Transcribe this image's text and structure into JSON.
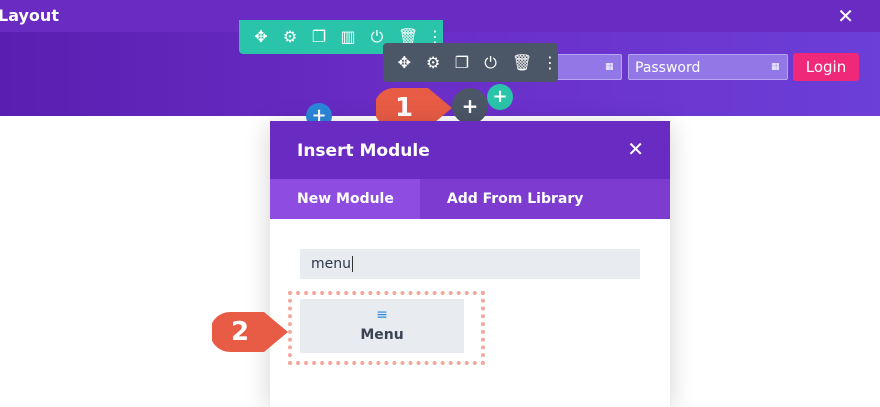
{
  "titlebar": {
    "title": "Layout",
    "close_icon": "close-icon"
  },
  "green_toolbar": {
    "icons": [
      "move-icon",
      "gear-icon",
      "duplicate-icon",
      "columns-icon",
      "power-icon",
      "trash-icon",
      "more-icon"
    ]
  },
  "gray_toolbar": {
    "icons": [
      "move-icon",
      "gear-icon",
      "duplicate-icon",
      "power-icon",
      "trash-icon",
      "more-icon"
    ]
  },
  "login_form": {
    "password_placeholder": "Password",
    "login_label": "Login"
  },
  "callouts": {
    "first": "1",
    "second": "2"
  },
  "modal": {
    "title": "Insert Module",
    "tabs": [
      {
        "label": "New Module",
        "active": true
      },
      {
        "label": "Add From Library",
        "active": false
      }
    ],
    "search_value": "menu",
    "results": [
      {
        "label": "Menu",
        "icon": "menu-icon"
      }
    ]
  },
  "colors": {
    "brand_purple": "#6a2bc2",
    "teal": "#29c4a9",
    "login_pink": "#f0287a",
    "callout": "#e85c45"
  }
}
